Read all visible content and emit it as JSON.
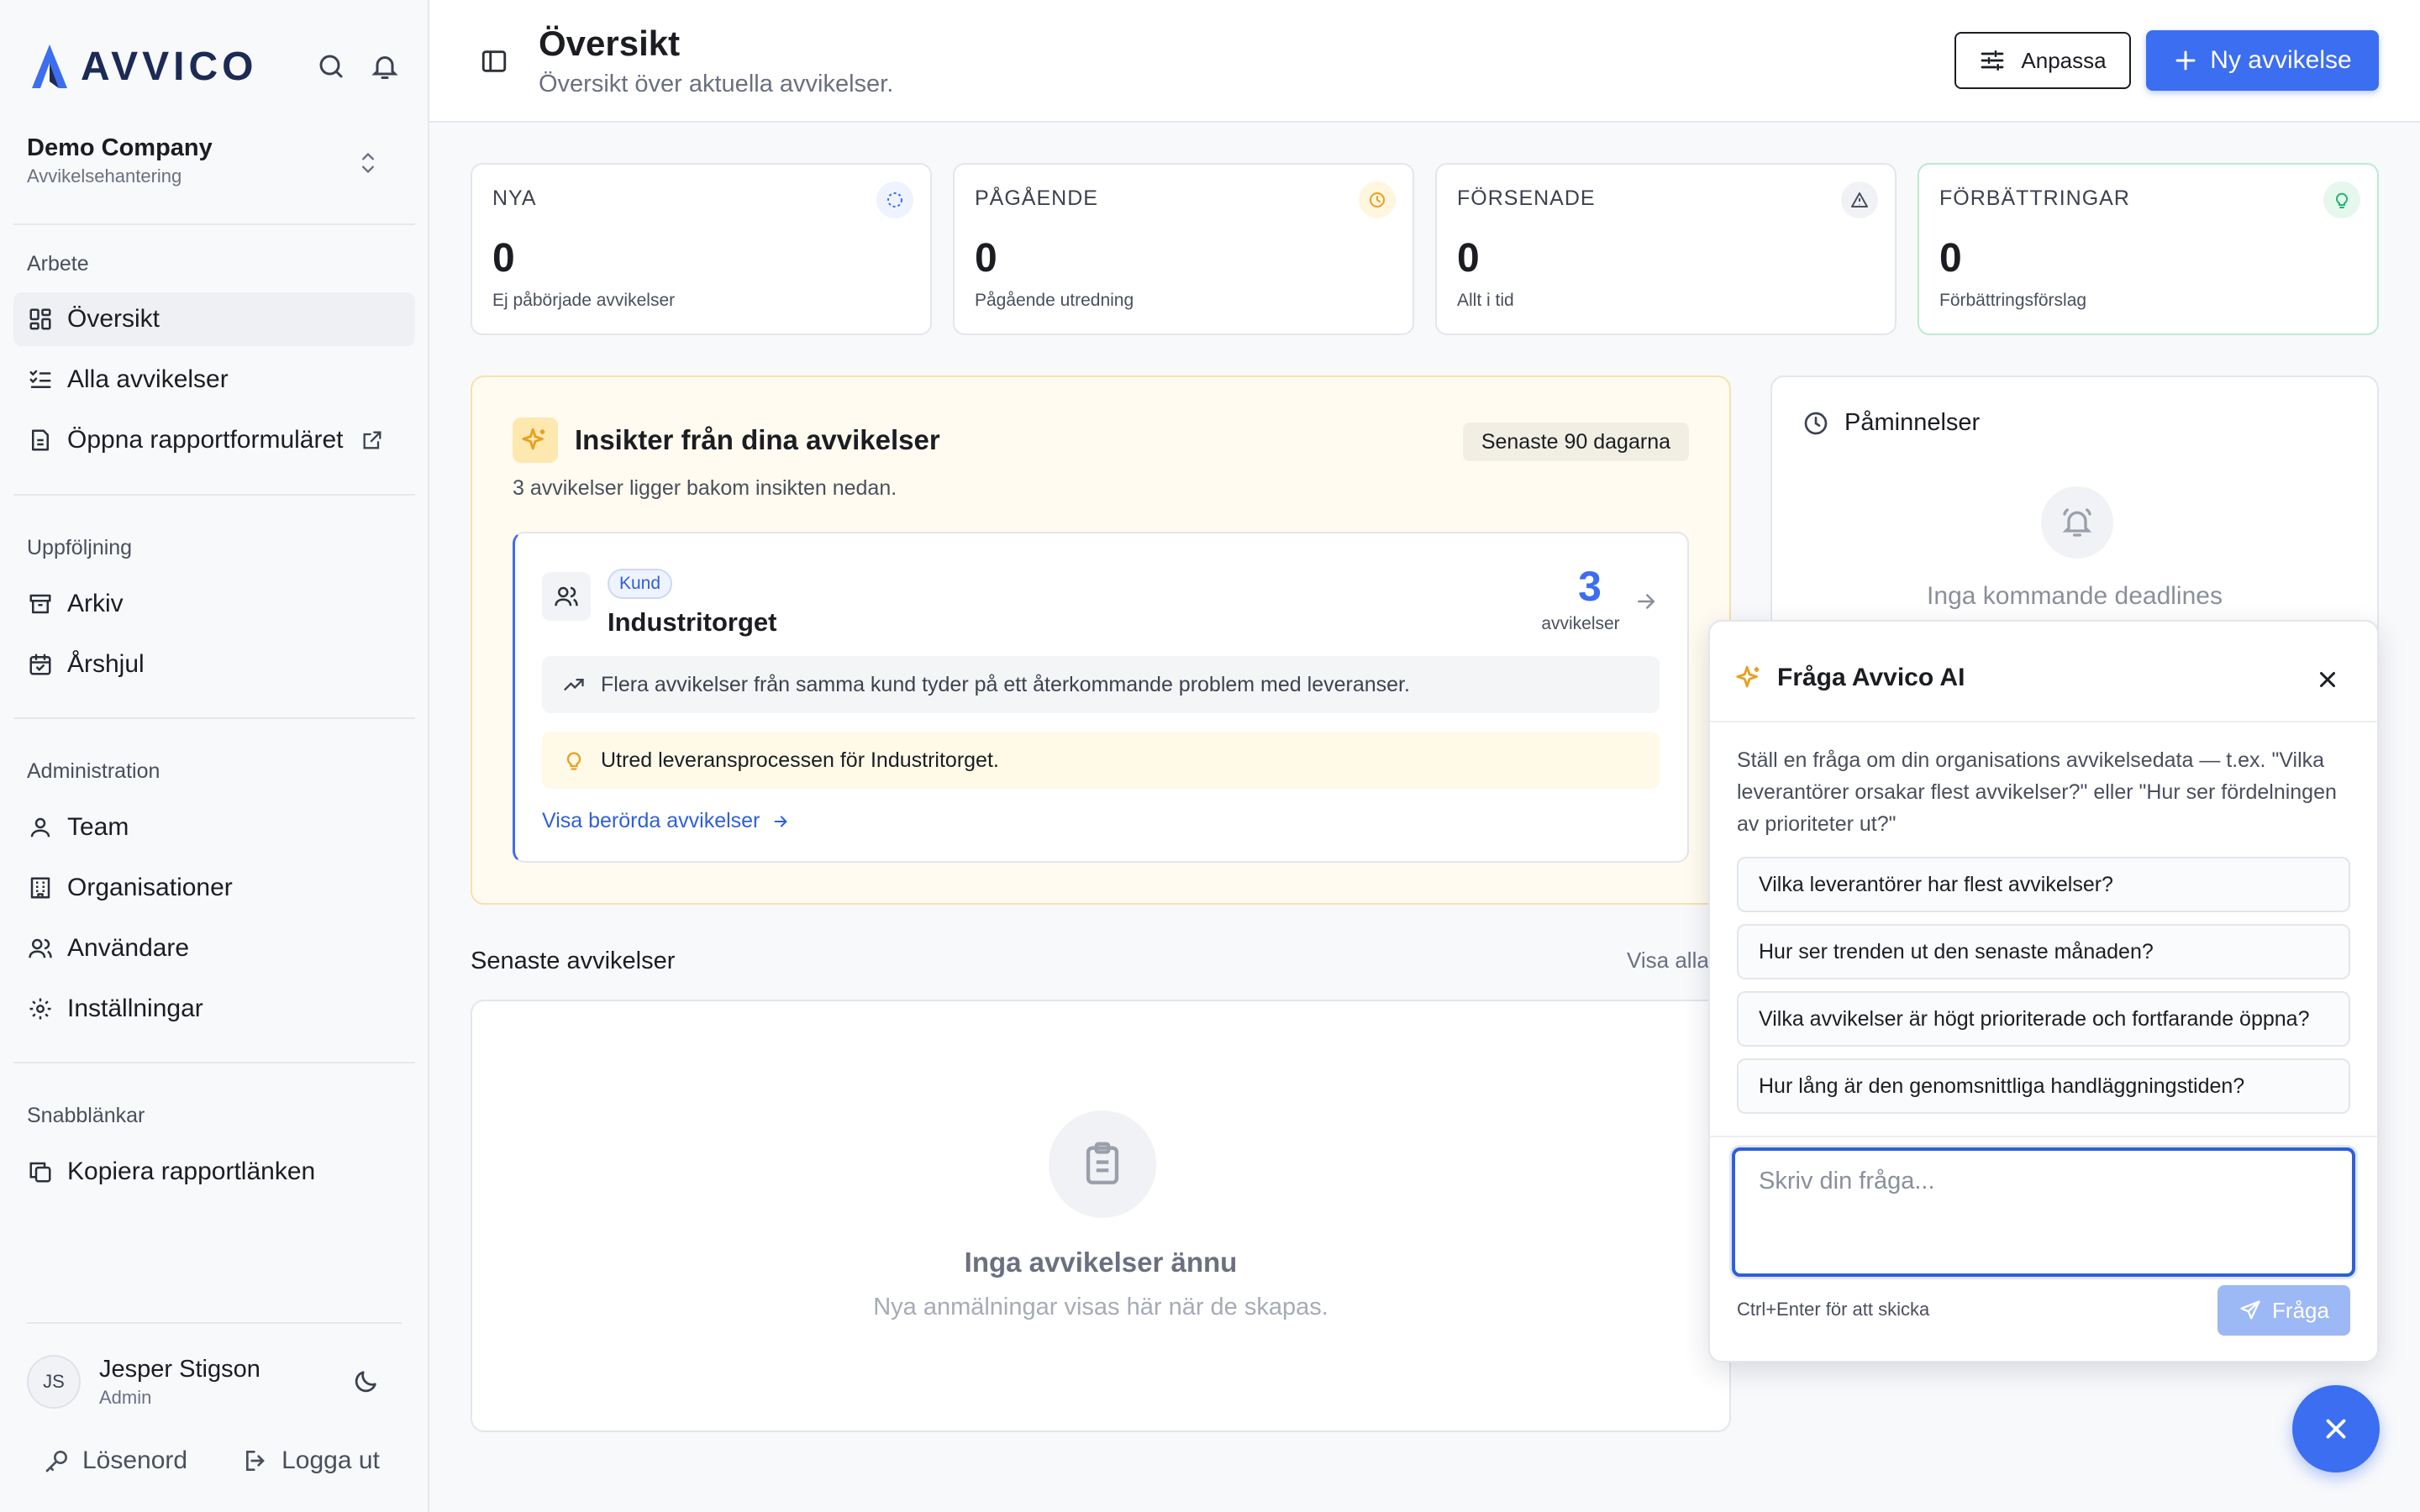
{
  "app": {
    "logo_text": "AVVICO",
    "brand_color": "#3b6ef0"
  },
  "company": {
    "name": "Demo Company",
    "subtitle": "Avvikelsehantering"
  },
  "nav": {
    "sections": {
      "work": "Arbete",
      "followup": "Uppföljning",
      "admin": "Administration",
      "quicklinks": "Snabblänkar"
    },
    "items": {
      "overview": "Översikt",
      "all": "Alla avvikelser",
      "report_form": "Öppna rapportformuläret",
      "archive": "Arkiv",
      "year_wheel": "Årshjul",
      "team": "Team",
      "organisations": "Organisationer",
      "users": "Användare",
      "settings": "Inställningar",
      "copy_link": "Kopiera rapportlänken"
    }
  },
  "user": {
    "initials": "JS",
    "name": "Jesper Stigson",
    "role": "Admin"
  },
  "footer_links": {
    "password": "Lösenord",
    "logout": "Logga ut"
  },
  "header": {
    "title": "Översikt",
    "subtitle": "Översikt över aktuella avvikelser.",
    "customize_label": "Anpassa",
    "new_label": "Ny avvikelse"
  },
  "stats": [
    {
      "label": "NYA",
      "value": "0",
      "desc": "Ej påbörjade avvikelser",
      "icon": "loader-icon",
      "color": "#3b6ef0"
    },
    {
      "label": "PÅGÅENDE",
      "value": "0",
      "desc": "Pågående utredning",
      "icon": "clock-icon",
      "color": "#e8a020"
    },
    {
      "label": "FÖRSENADE",
      "value": "0",
      "desc": "Allt i tid",
      "icon": "warning-icon",
      "color": "#4a4f5c"
    },
    {
      "label": "FÖRBÄTTRINGAR",
      "value": "0",
      "desc": "Förbättringsförslag",
      "icon": "lightbulb-icon",
      "color": "#22b573"
    }
  ],
  "insights": {
    "title": "Insikter från dina avvikelser",
    "period": "Senaste 90 dagarna",
    "subtitle": "3 avvikelser ligger bakom insikten nedan.",
    "card": {
      "tag": "Kund",
      "name": "Industritorget",
      "count": "3",
      "count_label": "avvikelser",
      "observation": "Flera avvikelser från samma kund tyder på ett återkommande problem med leveranser.",
      "action": "Utred leveransprocessen för Industritorget.",
      "link": "Visa berörda avvikelser"
    }
  },
  "reminders": {
    "title": "Påminnelser",
    "empty": "Inga kommande deadlines"
  },
  "recent": {
    "title": "Senaste avvikelser",
    "view_all": "Visa alla",
    "empty_title": "Inga avvikelser ännu",
    "empty_sub": "Nya anmälningar visas här när de skapas."
  },
  "ai": {
    "title": "Fråga Avvico AI",
    "intro": "Ställ en fråga om din organisations avvikelsedata — t.ex. \"Vilka leverantörer orsakar flest avvikelser?\" eller \"Hur ser fördelningen av prioriteter ut?\"",
    "suggestions": [
      "Vilka leverantörer har flest avvikelser?",
      "Hur ser trenden ut den senaste månaden?",
      "Vilka avvikelser är högt prioriterade och fortfarande öppna?",
      "Hur lång är den genomsnittliga handläggningstiden?"
    ],
    "placeholder": "Skriv din fråga...",
    "hint": "Ctrl+Enter för att skicka",
    "send_label": "Fråga"
  }
}
